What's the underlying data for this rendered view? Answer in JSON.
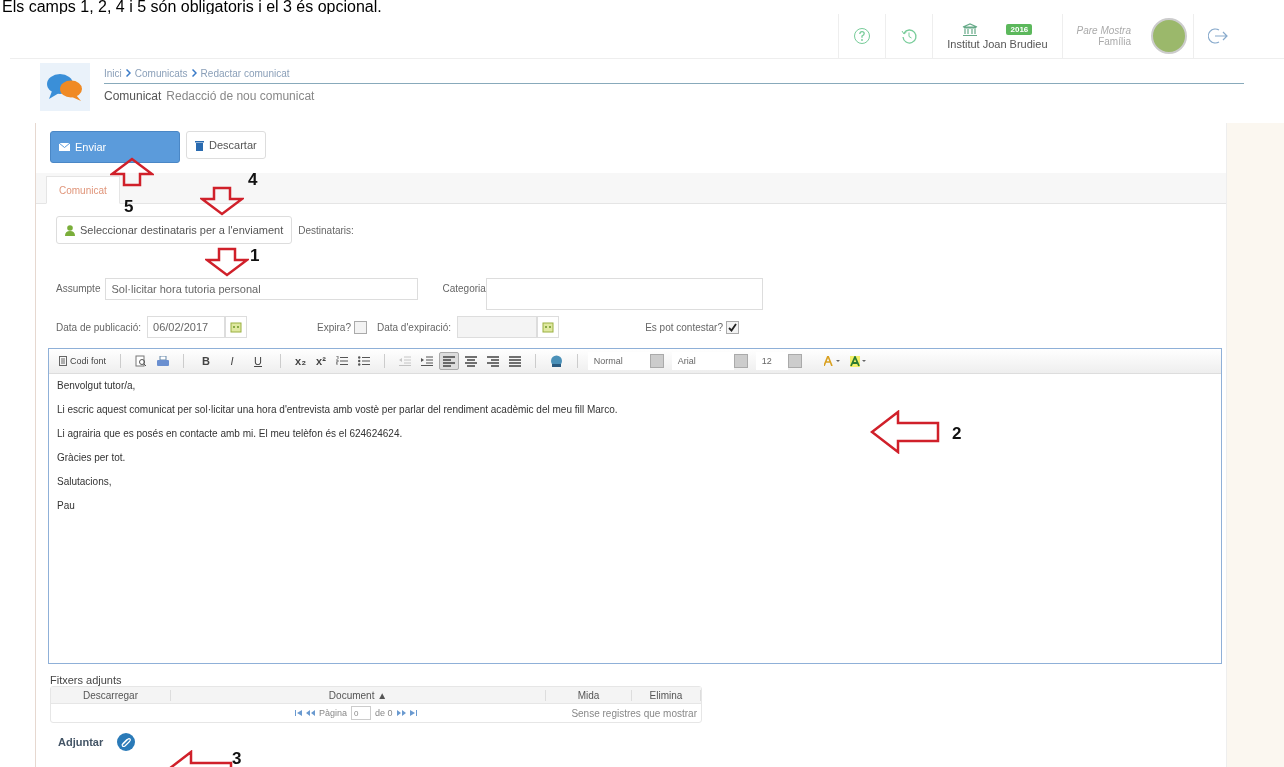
{
  "caption": "Els camps 1, 2, 4 i 5 són obligatoris i el 3 és opcional.",
  "header": {
    "badge": "2016",
    "school": "Institut Joan Brudieu",
    "user_name": "Pare Mostra",
    "user_role": "Família"
  },
  "breadcrumb": [
    "Inici",
    "Comunicats",
    "Redactar comunicat"
  ],
  "page_title": {
    "title": "Comunicat",
    "subtitle": "Redacció de nou comunicat"
  },
  "actions": [
    {
      "label": "Enviar",
      "kind": "primary"
    },
    {
      "label": "Descartar",
      "kind": "secondary"
    }
  ],
  "tabs": [
    {
      "label": "Comunicat",
      "selected": true
    }
  ],
  "recipients": {
    "button": "Seleccionar destinataris per a l'enviament",
    "label": "Destinataris:"
  },
  "subject": {
    "label": "Assumpte",
    "value": "Sol·licitar hora tutoria personal"
  },
  "category": {
    "label": "Categoria"
  },
  "publish_date": {
    "label": "Data de publicació:",
    "value": "06/02/2017"
  },
  "expires": {
    "label": "Expira?",
    "checked": false
  },
  "expiry_date": {
    "label": "Data d'expiració:"
  },
  "can_reply": {
    "label": "Es pot contestar?",
    "checked": true
  },
  "toolbar": {
    "source_label": "Codi font",
    "format_buttons": [
      "B",
      "I",
      "U"
    ],
    "script_buttons": [
      "x₂",
      "x²"
    ],
    "indent_buttons": [
      {
        "disabled": true
      },
      {
        "disabled": false
      }
    ],
    "align_buttons": [
      {
        "selected": true
      },
      {
        "selected": false
      },
      {
        "selected": false
      },
      {
        "selected": false
      }
    ],
    "dropdowns": [
      "Normal",
      "Arial",
      "12"
    ]
  },
  "body": [
    "Benvolgut tutor/a,",
    "Li escric aquest comunicat per sol·licitar una hora d'entrevista amb vostè per parlar del rendiment acadèmic del meu fill Marco.",
    "Li agrairia que es posés en contacte amb mi. El meu telèfon és el 624624624.",
    "Gràcies per tot.",
    "Salutacions,",
    "Pau"
  ],
  "attachments": {
    "title": "Fitxers adjunts",
    "columns": [
      "Descarregar",
      "Document ▲",
      "Mida",
      "Elimina"
    ],
    "page_label": "Pàgina",
    "page_value": "0",
    "of_label": "de 0",
    "empty": "Sense registres que mostrar"
  },
  "attach": {
    "label": "Adjuntar"
  },
  "annotations": [
    {
      "number": "1",
      "kind": "down"
    },
    {
      "number": "2",
      "kind": "left"
    },
    {
      "number": "3",
      "kind": "left"
    },
    {
      "number": "4",
      "kind": "down"
    },
    {
      "number": "5",
      "kind": "up"
    }
  ]
}
